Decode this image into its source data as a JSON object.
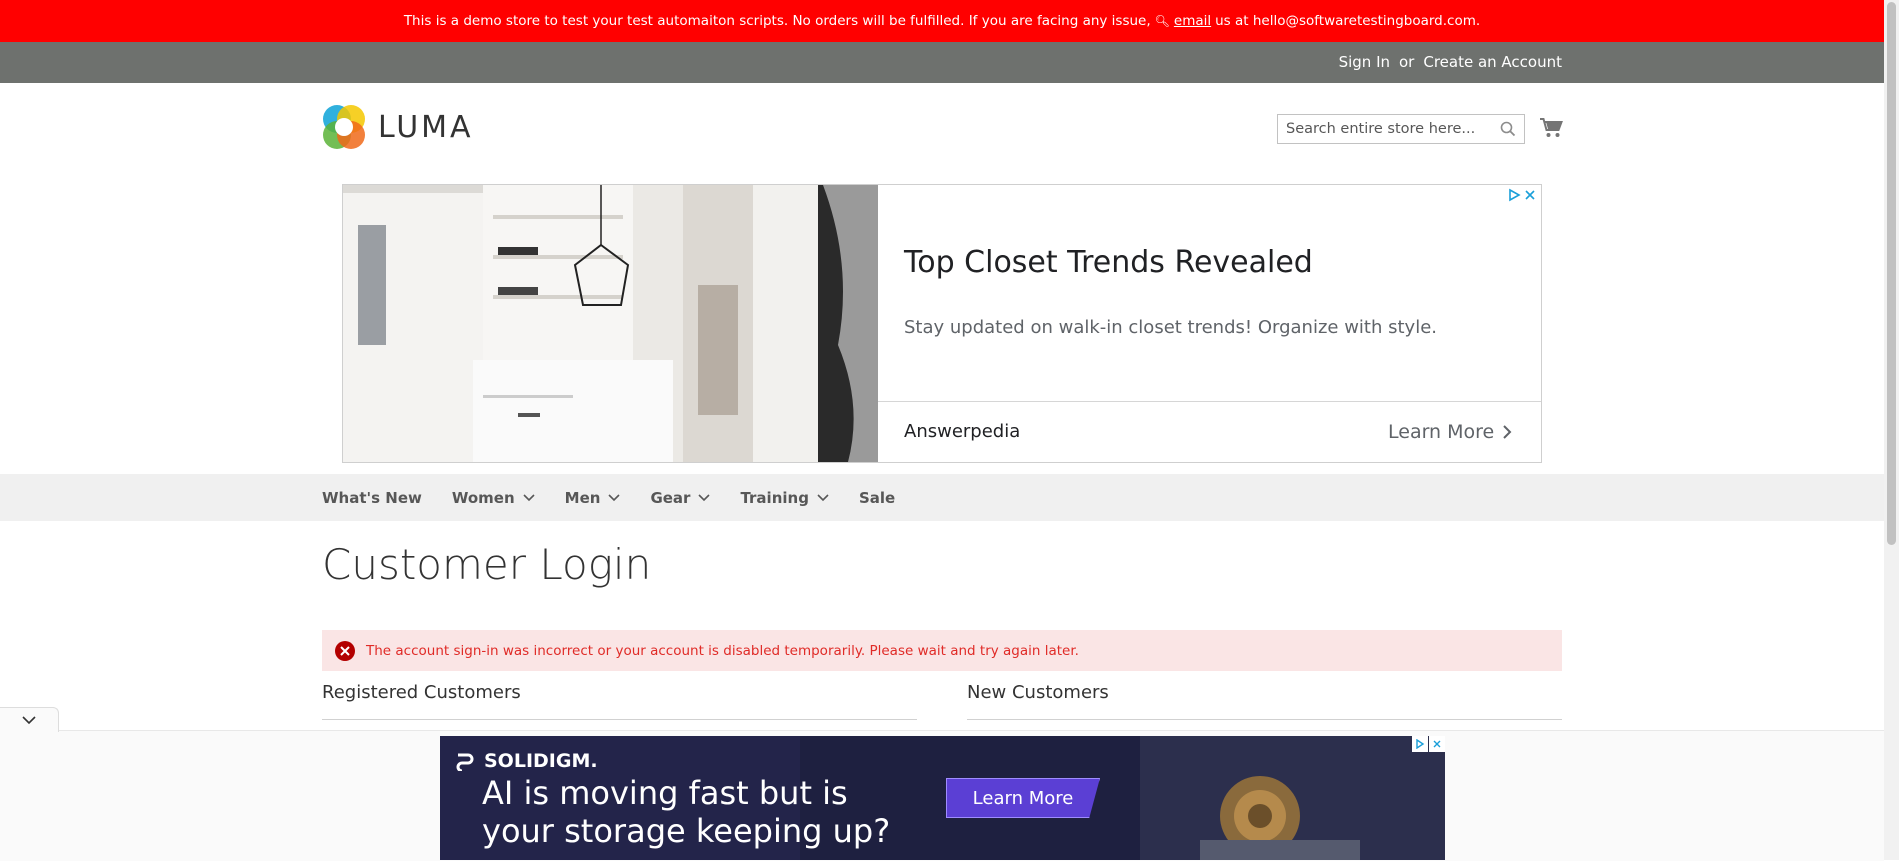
{
  "demo_banner": {
    "text_before": "This is a demo store to test your test automaiton scripts. No orders will be fulfilled. If you are facing any issue,",
    "email_link": "email",
    "text_after": "us at hello@softwaretestingboard.com."
  },
  "header": {
    "sign_in": "Sign In",
    "or": "or",
    "create_account": "Create an Account"
  },
  "logo": {
    "text": "LUMA"
  },
  "search": {
    "placeholder": "Search entire store here...",
    "icon": "search-icon"
  },
  "cart": {
    "icon": "cart-icon"
  },
  "ad_top": {
    "title": "Top Closet Trends Revealed",
    "description": "Stay updated on walk-in closet trends! Organize with style.",
    "brand": "Answerpedia",
    "cta": "Learn More"
  },
  "nav": {
    "items": [
      {
        "label": "What's New",
        "has_dropdown": false
      },
      {
        "label": "Women",
        "has_dropdown": true
      },
      {
        "label": "Men",
        "has_dropdown": true
      },
      {
        "label": "Gear",
        "has_dropdown": true
      },
      {
        "label": "Training",
        "has_dropdown": true
      },
      {
        "label": "Sale",
        "has_dropdown": false
      }
    ]
  },
  "page": {
    "title": "Customer Login",
    "error_message": "The account sign-in was incorrect or your account is disabled temporarily. Please wait and try again later.",
    "registered_title": "Registered Customers",
    "new_title": "New Customers"
  },
  "ad_bottom": {
    "brand": "SOLIDIGM.",
    "headline": "AI is moving fast but is your storage keeping up?",
    "cta": "Learn More"
  },
  "colors": {
    "banner": "#ff0000",
    "header_panel": "#6e716e",
    "nav_bg": "#f0f0f0",
    "error_bg": "#fae5e5",
    "error_text": "#e02b27"
  }
}
